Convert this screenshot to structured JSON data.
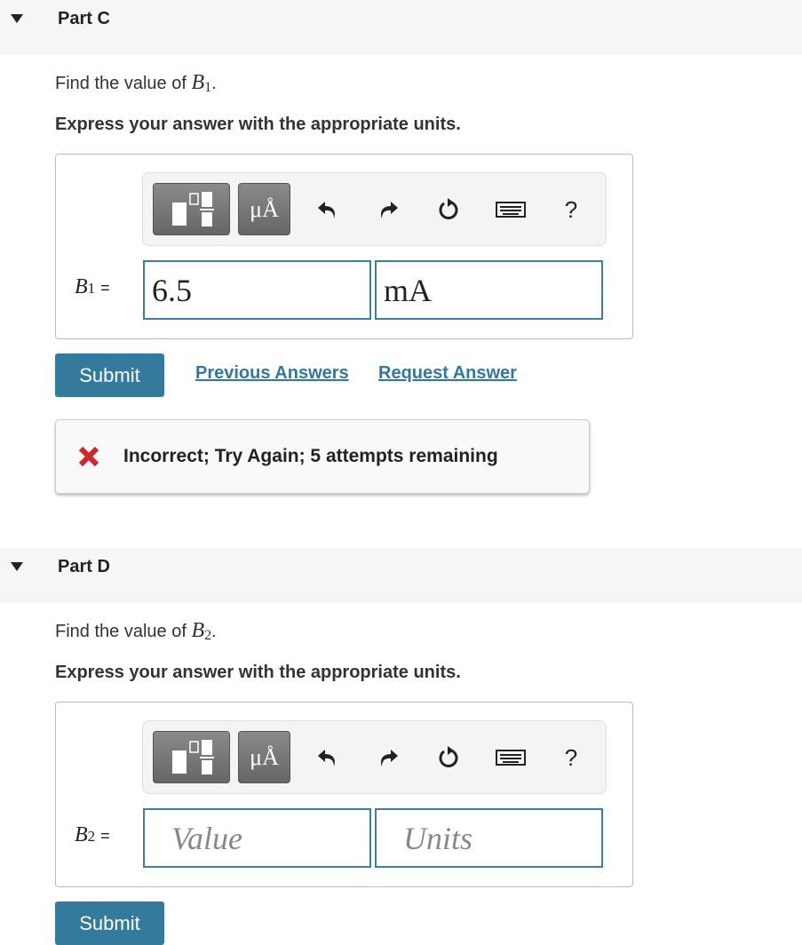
{
  "parts": [
    {
      "title": "Part C",
      "question_prefix": "Find the value of ",
      "var": "B",
      "sub": "1",
      "period": ".",
      "instruction": "Express your answer with the appropriate units.",
      "label_sub": "1",
      "equals": "=",
      "value": "6.5",
      "units": "mA",
      "value_placeholder": "Value",
      "units_placeholder": "Units"
    },
    {
      "title": "Part D",
      "question_prefix": "Find the value of ",
      "var": "B",
      "sub": "2",
      "period": ".",
      "instruction": "Express your answer with the appropriate units.",
      "label_sub": "2",
      "equals": "=",
      "value": "",
      "units": "",
      "value_placeholder": "Value",
      "units_placeholder": "Units"
    }
  ],
  "toolbar": {
    "units_button": "μÅ",
    "help": "?",
    "icons": [
      "templates-icon",
      "units-icon",
      "undo-icon",
      "redo-icon",
      "reset-icon",
      "keyboard-icon",
      "help-icon"
    ]
  },
  "actions": {
    "submit": "Submit",
    "previous_answers": "Previous Answers",
    "request_answer": "Request Answer"
  },
  "feedback": {
    "message": "Incorrect; Try Again; 5 attempts remaining",
    "icon": "x-icon",
    "color": "#d0262c"
  },
  "colors": {
    "accent": "#337a9c",
    "link": "#2f78a0",
    "input_border": "#3e7fa0"
  }
}
